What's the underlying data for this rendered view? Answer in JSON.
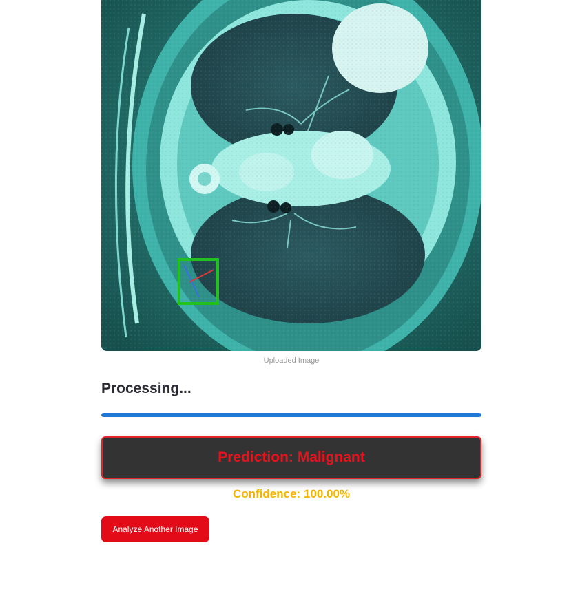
{
  "image": {
    "caption": "Uploaded Image",
    "description_icon": "ct-scan-image"
  },
  "status": {
    "processing_label": "Processing...",
    "progress_percent": 100,
    "progress_color": "#1f77d6"
  },
  "result": {
    "prediction": "Prediction: Malignant",
    "confidence": "Confidence: 100.00%",
    "prediction_color": "#e3141c",
    "confidence_color": "#f4b400"
  },
  "actions": {
    "analyze_another": "Analyze Another Image",
    "button_color": "#e30b17"
  }
}
